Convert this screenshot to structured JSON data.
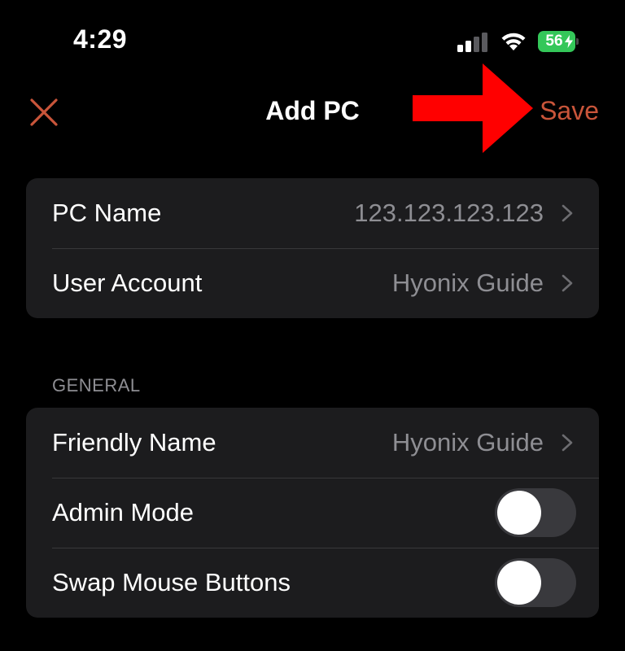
{
  "status_bar": {
    "time": "4:29",
    "battery_level": "56",
    "signal_icon": "cellular-signal-icon",
    "wifi_icon": "wifi-icon",
    "battery_icon": "battery-charging-icon",
    "battery_color": "#34c759"
  },
  "nav": {
    "title": "Add PC",
    "save_label": "Save",
    "close_icon": "close-icon",
    "accent_color": "#c9553a",
    "annotation_icon": "red-arrow-icon",
    "annotation_color": "#ff0000"
  },
  "connection_group": {
    "rows": [
      {
        "label": "PC Name",
        "value": "123.123.123.123"
      },
      {
        "label": "User Account",
        "value": "Hyonix Guide"
      }
    ]
  },
  "general_group": {
    "header": "GENERAL",
    "friendly_name": {
      "label": "Friendly Name",
      "value": "Hyonix Guide"
    },
    "admin_mode": {
      "label": "Admin Mode",
      "enabled": false
    },
    "swap_mouse_buttons": {
      "label": "Swap Mouse Buttons",
      "enabled": false
    }
  }
}
